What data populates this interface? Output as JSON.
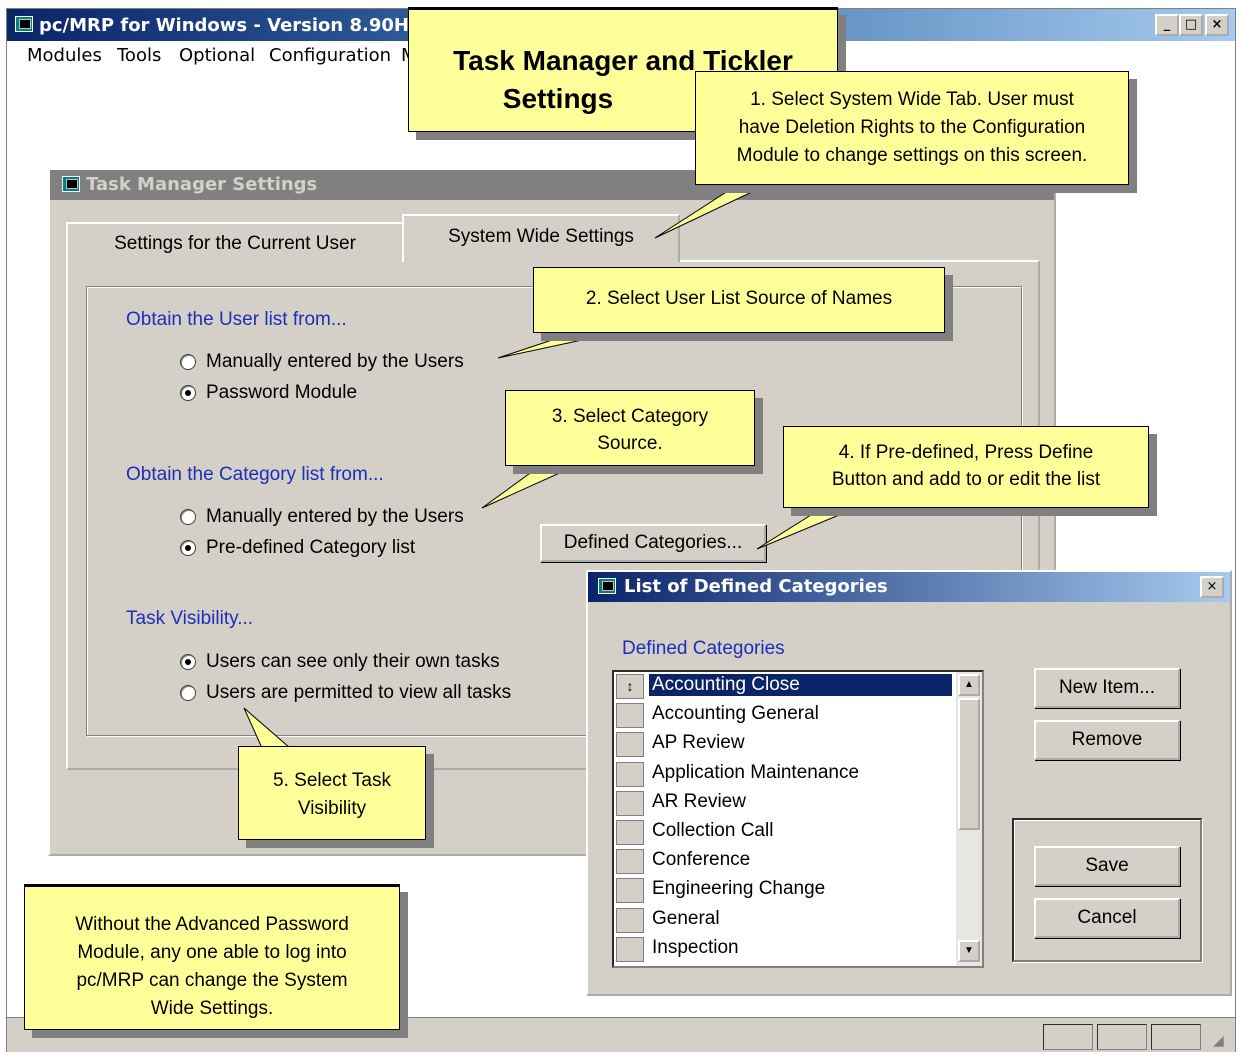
{
  "app": {
    "title": "pc/MRP for Windows - Version 8.90H",
    "menu": [
      "Modules",
      "Tools",
      "Optional",
      "Configuration",
      "M"
    ]
  },
  "main_caption": {
    "line1": "Task Manager and Tickler",
    "line2": "Settings"
  },
  "task_dialog": {
    "title": "Task Manager Settings",
    "tabs": [
      "Settings for the Current User",
      "System Wide Settings"
    ],
    "user_list": {
      "heading": "Obtain the User list from...",
      "options": [
        "Manually entered by the Users",
        "Password Module"
      ],
      "selected": 1
    },
    "category_list": {
      "heading": "Obtain the Category list from...",
      "options": [
        "Manually entered by the Users",
        "Pre-defined Category list"
      ],
      "selected": 1,
      "define_button": "Defined Categories..."
    },
    "visibility": {
      "heading": "Task Visibility...",
      "options": [
        "Users can see only their own tasks",
        "Users are permitted to view all tasks"
      ],
      "selected": 0
    }
  },
  "categories_dialog": {
    "title": "List of Defined Categories",
    "list_label": "Defined Categories",
    "items": [
      "Accounting Close",
      "Accounting General",
      "AP Review",
      "Application Maintenance",
      "AR Review",
      "Collection Call",
      "Conference",
      "Engineering Change",
      "General",
      "Inspection"
    ],
    "selected_index": 0,
    "buttons": {
      "new_item": "New Item...",
      "remove": "Remove",
      "save": "Save",
      "cancel": "Cancel"
    }
  },
  "callouts": {
    "c1": {
      "line1": "1. Select System Wide Tab.  User must",
      "line2": "have Deletion Rights to the Configuration",
      "line3": "Module to change settings on this screen."
    },
    "c2": "2. Select User List Source of Names",
    "c3": {
      "line1": "3. Select Category",
      "line2": "Source."
    },
    "c4": {
      "line1": "4. If Pre-defined, Press Define",
      "line2": "Button and add to or edit the list"
    },
    "c5": {
      "line1": "5. Select Task",
      "line2": "Visibility"
    },
    "note": {
      "line1": "Without the Advanced Password",
      "line2": "Module, any one able to log into",
      "line3": "pc/MRP can change the System",
      "line4": "Wide Settings."
    }
  },
  "colors": {
    "callout": "#ffff99",
    "heading_blue": "#1b2fb8",
    "titlebar": "#0a246a",
    "dialog_face": "#d4d0c8"
  }
}
